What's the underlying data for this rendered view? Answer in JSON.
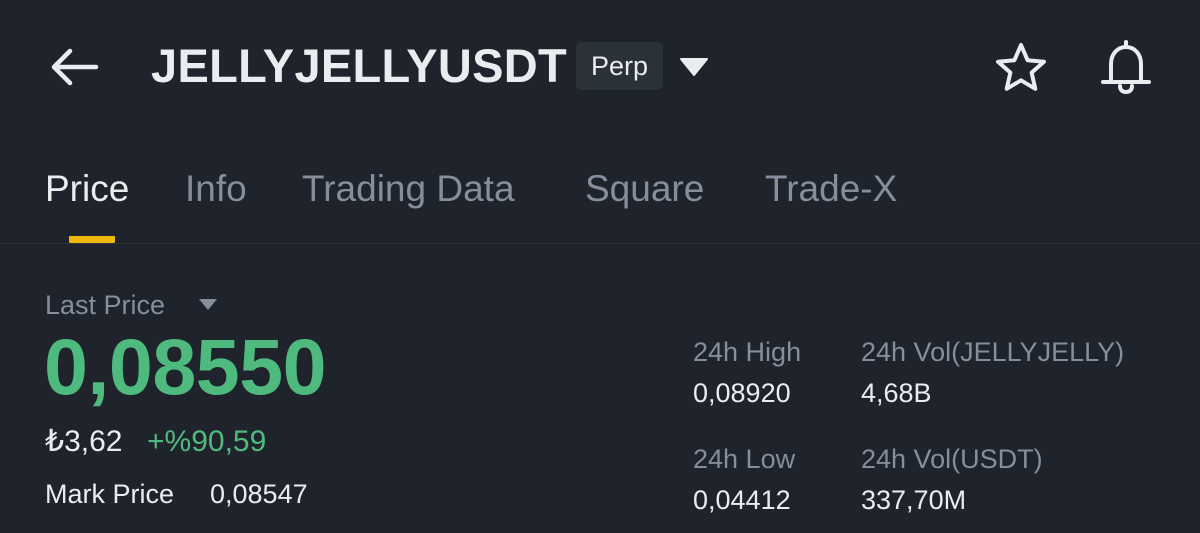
{
  "header": {
    "symbol": "JELLYJELLYUSDT",
    "contract_type": "Perp"
  },
  "tabs": [
    {
      "label": "Price",
      "active": true
    },
    {
      "label": "Info",
      "active": false
    },
    {
      "label": "Trading Data",
      "active": false
    },
    {
      "label": "Square",
      "active": false
    },
    {
      "label": "Trade-X",
      "active": false
    }
  ],
  "price": {
    "label": "Last Price",
    "last_price": "0,08550",
    "fiat_price": "₺3,62",
    "change_pct": "+%90,59",
    "mark_label": "Mark Price",
    "mark_price": "0,08547"
  },
  "stats": {
    "high_label": "24h High",
    "high_value": "0,08920",
    "low_label": "24h Low",
    "low_value": "0,04412",
    "vol_base_label": "24h Vol(JELLYJELLY)",
    "vol_base_value": "4,68B",
    "vol_quote_label": "24h Vol(USDT)",
    "vol_quote_value": "337,70M"
  },
  "colors": {
    "background": "#1f232b",
    "positive": "#4eba7e",
    "accent": "#f0b90b",
    "muted": "#848e9c"
  },
  "icons": [
    "back-arrow-icon",
    "caret-down-icon",
    "star-icon",
    "bell-icon"
  ]
}
